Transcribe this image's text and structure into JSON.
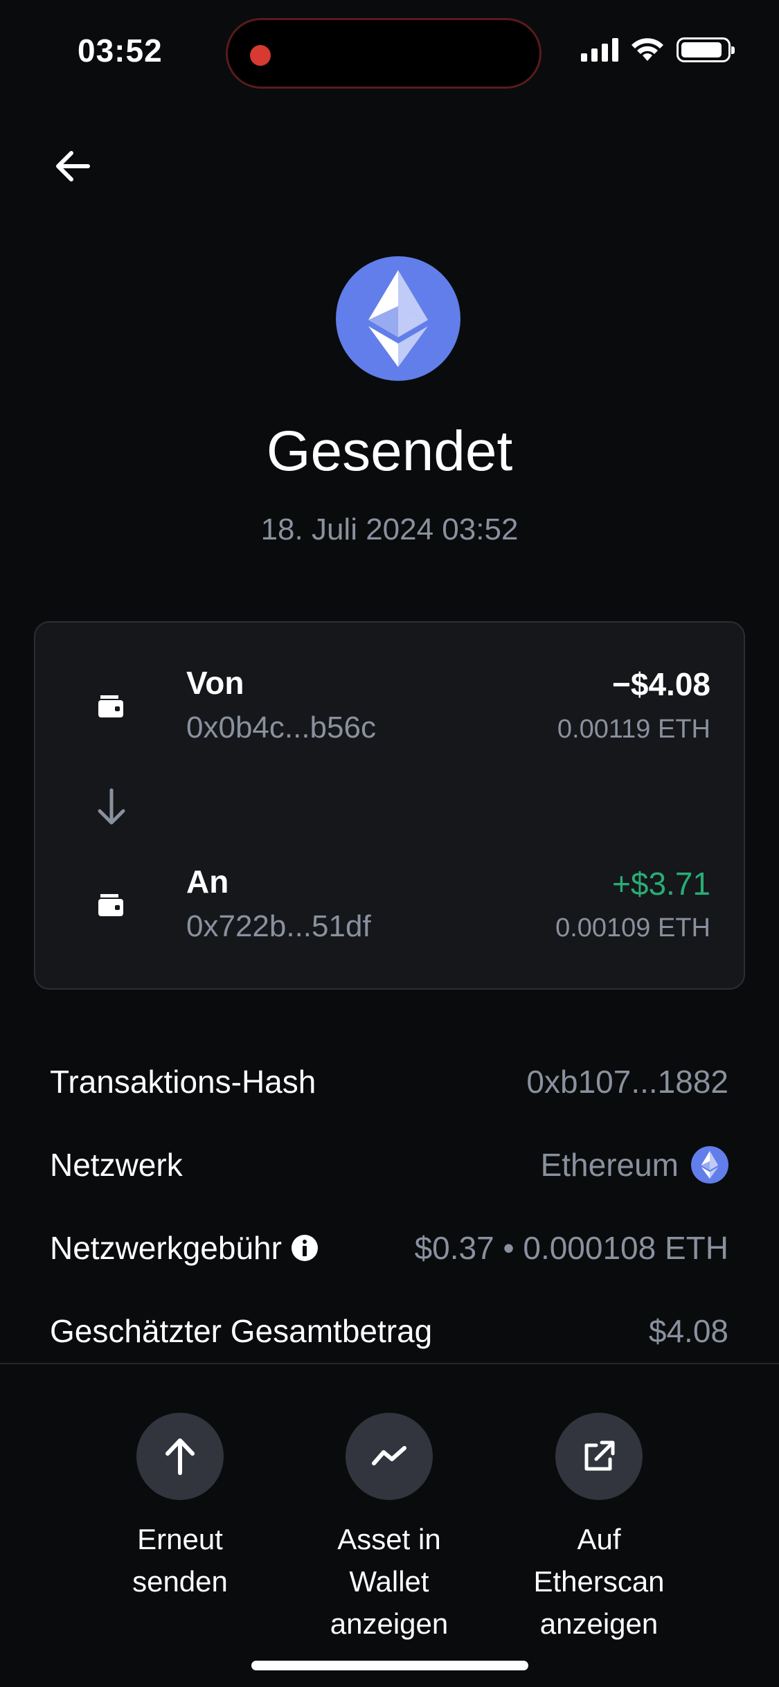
{
  "status_bar": {
    "time": "03:52",
    "icons": [
      "signal-icon",
      "wifi-icon",
      "battery-icon"
    ]
  },
  "header": {
    "back_icon": "arrow-left-icon",
    "asset_icon": "ethereum-icon",
    "title": "Gesendet",
    "date": "18. Juli 2024 03:52"
  },
  "transfer": {
    "from": {
      "label": "Von",
      "address": "0x0b4c...b56c",
      "amount": "−$4.08",
      "eth": "0.00119 ETH",
      "icon": "wallet-icon"
    },
    "to": {
      "label": "An",
      "address": "0x722b...51df",
      "amount": "+$3.71",
      "eth": "0.00109 ETH",
      "icon": "wallet-icon"
    },
    "arrow_icon": "arrow-down-icon"
  },
  "details": {
    "hash_label": "Transaktions-Hash",
    "hash_value": "0xb107...1882",
    "network_label": "Netzwerk",
    "network_value": "Ethereum",
    "fee_label": "Netzwerkgebühr",
    "fee_value": "$0.37 • 0.000108 ETH",
    "total_label": "Geschätzter Gesamtbetrag",
    "total_value": "$4.08"
  },
  "actions": [
    {
      "label": "Erneut\nsenden",
      "icon": "arrow-up-icon"
    },
    {
      "label": "Asset in\nWallet\nanzeigen",
      "icon": "chart-line-icon"
    },
    {
      "label": "Auf\nEtherscan\nanzeigen",
      "icon": "external-link-icon"
    }
  ],
  "colors": {
    "background": "#0a0b0d",
    "card": "#16171b",
    "secondary_text": "#8a919e",
    "positive": "#27ad75",
    "ethereum": "#627eea",
    "action_circle": "#32353d"
  }
}
